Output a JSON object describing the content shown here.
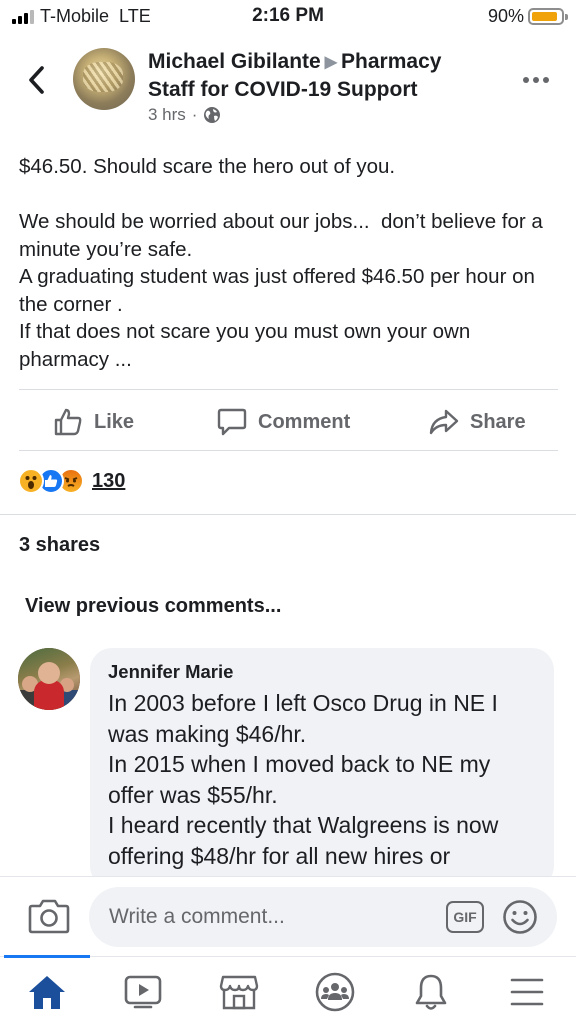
{
  "status_bar": {
    "carrier": "T-Mobile",
    "network": "LTE",
    "time": "2:16 PM",
    "battery_percent": "90%",
    "battery_level": 0.9,
    "battery_color": "#f0a20b"
  },
  "post": {
    "author": "Michael Gibilante",
    "group": "Pharmacy Staff for COVID-19 Support",
    "time_ago": "3 hrs",
    "visibility_icon": "globe-icon",
    "body": [
      "$46.50. Should scare the hero out of you.",
      "",
      "We should be worried about our jobs...  don’t believe for a minute you’re safe.",
      "A graduating student was just offered $46.50 per hour on the corner .",
      "If that does not scare you you must own your own pharmacy ..."
    ],
    "actions": {
      "like": "Like",
      "comment": "Comment",
      "share": "Share"
    },
    "reaction_count": "130",
    "reaction_icons": [
      "wow-reaction-icon",
      "like-reaction-icon",
      "angry-reaction-icon"
    ],
    "shares": "3 shares",
    "view_previous": "View previous comments..."
  },
  "comment": {
    "author": "Jennifer Marie",
    "lines": [
      "In 2003 before I left Osco Drug in NE I was making $46/hr.",
      "In 2015 when I moved back to NE my offer was $55/hr.",
      "I heard recently that Walgreens is now offering  $48/hr for all new hires or"
    ]
  },
  "composer": {
    "placeholder": "Write a comment...",
    "gif_label": "GIF"
  },
  "tabbar": {
    "items": [
      "home-tab",
      "watch-tab",
      "marketplace-tab",
      "groups-tab",
      "notifications-tab",
      "menu-tab"
    ],
    "active": "home-tab",
    "accent": "#1877f2"
  },
  "colors": {
    "text": "#1c1e21",
    "secondary": "#65676b",
    "bubble": "#f0f2f5",
    "facebook_blue": "#1877f2"
  }
}
